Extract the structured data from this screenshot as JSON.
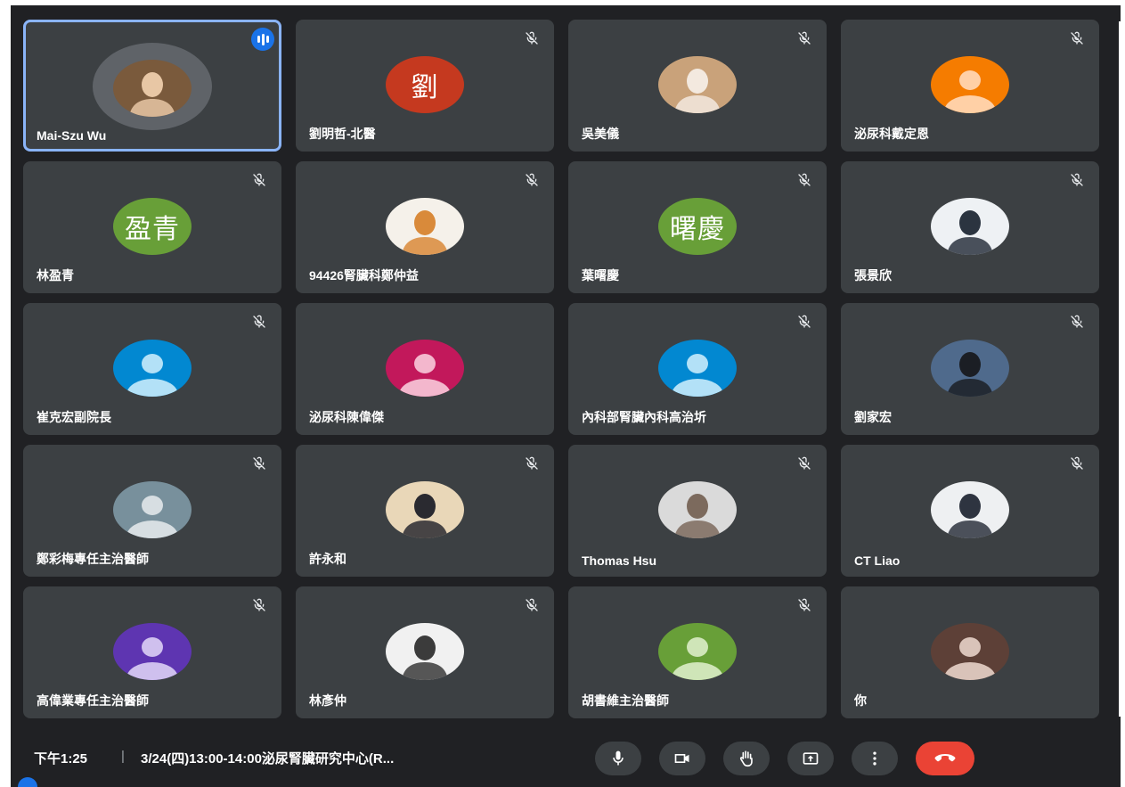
{
  "participants": [
    {
      "name": "Mai-Szu Wu",
      "muted": false,
      "speaking": true,
      "avatar": {
        "kind": "photo",
        "bg": "#7a5a3c",
        "fg": "#e8c7a5",
        "ring": true
      }
    },
    {
      "name": "劉明哲-北醫",
      "muted": true,
      "avatar": {
        "kind": "initials",
        "text": "劉",
        "bg": "#c5391f"
      }
    },
    {
      "name": "吳美儀",
      "muted": true,
      "avatar": {
        "kind": "photo",
        "bg": "#c9a27a",
        "fg": "#f3e9df"
      }
    },
    {
      "name": "泌尿科戴定恩",
      "muted": true,
      "avatar": {
        "kind": "silhouette",
        "bg": "#f57c00",
        "fg": "#ffd0a6"
      }
    },
    {
      "name": "林盈青",
      "muted": true,
      "avatar": {
        "kind": "initials",
        "text": "盈青",
        "bg": "#689f38"
      }
    },
    {
      "name": "94426腎臟科鄭仲益",
      "muted": true,
      "avatar": {
        "kind": "photo",
        "bg": "#f5f1ea",
        "fg": "#d98a3a"
      }
    },
    {
      "name": "葉曙慶",
      "muted": true,
      "avatar": {
        "kind": "initials",
        "text": "曙慶",
        "bg": "#689f38"
      }
    },
    {
      "name": "張景欣",
      "muted": true,
      "avatar": {
        "kind": "photo",
        "bg": "#eef1f4",
        "fg": "#2b3440"
      }
    },
    {
      "name": "崔克宏副院長",
      "muted": true,
      "avatar": {
        "kind": "silhouette",
        "bg": "#0288d1",
        "fg": "#b3e1f7"
      }
    },
    {
      "name": "泌尿科陳偉傑",
      "muted": false,
      "avatar": {
        "kind": "silhouette",
        "bg": "#c2185b",
        "fg": "#f3b7cd"
      }
    },
    {
      "name": "內科部腎臟內科高治圻",
      "muted": true,
      "avatar": {
        "kind": "silhouette",
        "bg": "#0288d1",
        "fg": "#b3e1f7"
      }
    },
    {
      "name": "劉家宏",
      "muted": true,
      "avatar": {
        "kind": "photo",
        "bg": "#4f6a8c",
        "fg": "#1b1e24"
      }
    },
    {
      "name": "鄭彩梅專任主治醫師",
      "muted": true,
      "avatar": {
        "kind": "silhouette",
        "bg": "#78909c",
        "fg": "#d7dee2"
      }
    },
    {
      "name": "許永和",
      "muted": true,
      "avatar": {
        "kind": "photo",
        "bg": "#e9d7b8",
        "fg": "#2a2a30"
      }
    },
    {
      "name": "Thomas Hsu",
      "muted": true,
      "avatar": {
        "kind": "photo",
        "bg": "#dadada",
        "fg": "#7c6a5d"
      }
    },
    {
      "name": "CT Liao",
      "muted": true,
      "avatar": {
        "kind": "photo",
        "bg": "#eef0f2",
        "fg": "#2e3440"
      }
    },
    {
      "name": "高偉業專任主治醫師",
      "muted": true,
      "avatar": {
        "kind": "silhouette",
        "bg": "#5e35b1",
        "fg": "#cfc0ee"
      }
    },
    {
      "name": "林彥仲",
      "muted": true,
      "avatar": {
        "kind": "photo",
        "bg": "#f1f1f1",
        "fg": "#3b3b3b"
      }
    },
    {
      "name": "胡書維主治醫師",
      "muted": true,
      "avatar": {
        "kind": "silhouette",
        "bg": "#689f38",
        "fg": "#cfe5b8"
      }
    },
    {
      "name": "你",
      "muted": false,
      "avatar": {
        "kind": "silhouette",
        "bg": "#5d4037",
        "fg": "#d9c3b9"
      }
    }
  ],
  "bottom_bar": {
    "time": "下午1:25",
    "separator": "|",
    "meeting_title": "3/24(四)13:00-14:00泌尿腎臟研究中心(R..."
  },
  "controls": [
    {
      "name": "microphone-button",
      "icon": "mic-icon"
    },
    {
      "name": "camera-button",
      "icon": "camera-icon"
    },
    {
      "name": "raise-hand-button",
      "icon": "hand-icon"
    },
    {
      "name": "present-screen-button",
      "icon": "present-icon"
    },
    {
      "name": "more-options-button",
      "icon": "more-vert-icon"
    },
    {
      "name": "leave-call-button",
      "icon": "hangup-icon"
    }
  ],
  "colors": {
    "background": "#202124",
    "tile": "#3c4043",
    "active_border": "#8ab4f8",
    "speaking": "#1a73e8",
    "hangup": "#ea4335"
  }
}
